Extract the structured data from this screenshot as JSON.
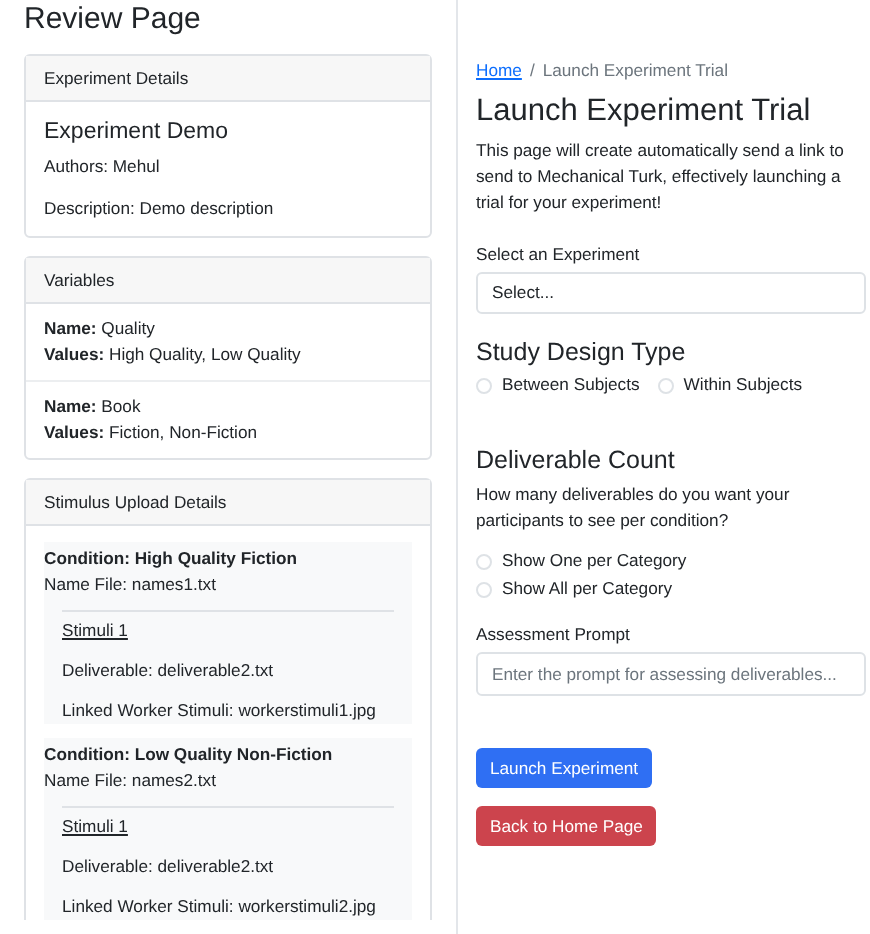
{
  "review": {
    "title": "Review Page",
    "experiment_details": {
      "header": "Experiment Details",
      "name": "Experiment Demo",
      "authors": "Authors: Mehul",
      "description": "Description: Demo description"
    },
    "variables": {
      "header": "Variables",
      "items": [
        {
          "name": "**Name:** Quality",
          "values": "**Values:** High Quality, Low Quality"
        },
        {
          "name": "**Name:** Book",
          "values": "**Values:** Fiction, Non-Fiction"
        }
      ]
    },
    "stimulus_upload": {
      "header": "Stimulus Upload Details",
      "conditions": [
        {
          "title": "Condition: High Quality Fiction",
          "name_file": "Name File: names1.txt",
          "stimuli": [
            {
              "title": "Stimuli 1",
              "deliverable": "Deliverable: deliverable2.txt",
              "linked": "Linked Worker Stimuli: workerstimuli1.jpg"
            }
          ]
        },
        {
          "title": "Condition: Low Quality Non-Fiction",
          "name_file": "Name File: names2.txt",
          "stimuli": [
            {
              "title": "Stimuli 1",
              "deliverable": "Deliverable: deliverable2.txt",
              "linked": "Linked Worker Stimuli: workerstimuli2.jpg"
            }
          ]
        }
      ]
    }
  },
  "launch": {
    "breadcrumb_separator": "/",
    "breadcrumb": [
      {
        "label": "Home",
        "kind": "link"
      },
      {
        "label": "Launch Experiment Trial",
        "kind": "current"
      }
    ],
    "title": "Launch Experiment Trial",
    "description": "This page will create automatically send a link to send to Mechanical Turk, effectively launching a trial for your experiment!",
    "select": {
      "label": "Select an Experiment",
      "value": "Select..."
    },
    "study_design": {
      "title": "Study Design Type",
      "options": [
        {
          "label": "Between Subjects",
          "selected": false
        },
        {
          "label": "Within Subjects",
          "selected": false
        }
      ]
    },
    "deliverable_count": {
      "title": "Deliverable Count",
      "question": "How many deliverables do you want your participants to see per condition?",
      "options": [
        {
          "label": "Show One per Category",
          "selected": false
        },
        {
          "label": "Show All per Category",
          "selected": false
        }
      ]
    },
    "assessment": {
      "label": "Assessment Prompt",
      "placeholder": "Enter the prompt for assessing deliverables..."
    },
    "buttons": [
      {
        "label": "Launch Experiment",
        "kind": "primary"
      },
      {
        "label": "Back to Home Page",
        "kind": "danger"
      }
    ]
  }
}
